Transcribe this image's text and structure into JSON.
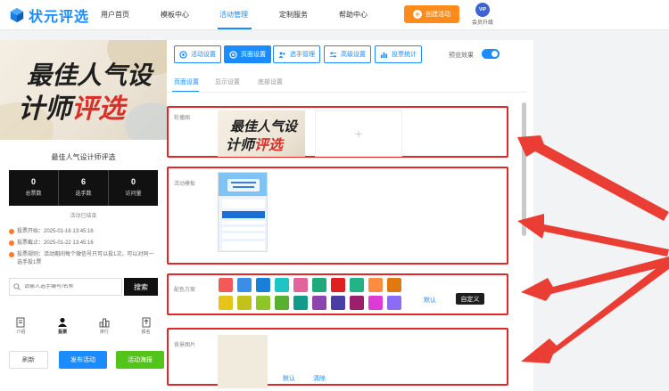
{
  "brand": {
    "name": "状元评选"
  },
  "nav": {
    "items": [
      "用户首页",
      "模板中心",
      "活动管理",
      "定制服务",
      "帮助中心"
    ],
    "active": "活动管理",
    "create_label": "创建活动",
    "vip_badge": "VIP",
    "vip_label": "会员升级"
  },
  "preview": {
    "banner_line1": "最佳人气设",
    "banner_line2a": "计师",
    "banner_line2b": "评选",
    "activity_title": "最佳人气设计师评选",
    "stats": [
      {
        "value": "0",
        "label": "总票数"
      },
      {
        "value": "6",
        "label": "选手数"
      },
      {
        "value": "0",
        "label": "访问量"
      }
    ],
    "status": "活动已结束",
    "info": [
      "投票开始：2025-01-16 13:45:16",
      "投票截止：2025-01-22 13:45:16",
      "投票规则：活动期间每个微信号只可以投1次，可以对同一选手投1票"
    ],
    "search_placeholder": "请输入选手编号/名称",
    "search_label": "搜索",
    "tabbar": [
      "介绍",
      "投票",
      "排行",
      "报名"
    ],
    "tabbar_active": "投票",
    "buttons": {
      "refresh": "刷新",
      "publish": "发布活动",
      "poster": "活动海报"
    }
  },
  "toolbar": {
    "buttons": [
      "活动设置",
      "页面设置",
      "选手管理",
      "高级设置",
      "投票统计"
    ],
    "active": "页面设置",
    "preview_label": "预览效果",
    "preview_on": true
  },
  "subtabs": {
    "items": [
      "页面设置",
      "显示设置",
      "底部设置"
    ],
    "active": "页面设置"
  },
  "sections": {
    "carousel_label": "轮播图",
    "template_label": "活动模板",
    "scheme_label": "配色方案",
    "scheme_default": "默认",
    "scheme_custom": "自定义",
    "scheme_colors": [
      "#f25a5a",
      "#3a8ee6",
      "#1a7fd6",
      "#1fc5c5",
      "#e2649a",
      "#20a97a",
      "#e02020",
      "#22b389",
      "#ff8c40",
      "#e07a10",
      "#e6c51a",
      "#c2c21a",
      "#8ec628",
      "#58b030",
      "#139a88",
      "#8e44ad",
      "#4a3ea6",
      "#9b1f6a",
      "#de3bd6",
      "#8a6df2"
    ],
    "bg_label": "背景图片",
    "bg_default": "默认",
    "bg_clear": "清除"
  },
  "colors": {
    "accent": "#1a8cff",
    "orange": "#ff8c1a",
    "highlight": "#e02828"
  }
}
